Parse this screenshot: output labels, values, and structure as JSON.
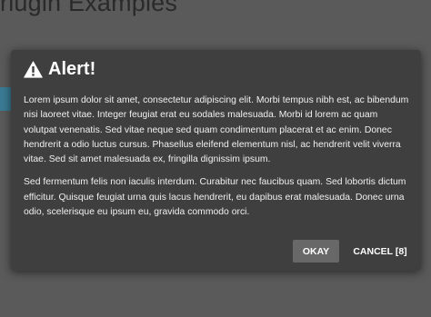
{
  "background": {
    "heading": "rlugin Examples"
  },
  "dialog": {
    "icon": "warning-icon",
    "title": "Alert!",
    "paragraphs": [
      "Lorem ipsum dolor sit amet, consectetur adipiscing elit. Morbi tempus nibh est, ac bibendum nisi laoreet vitae. Integer feugiat erat eu sodales malesuada. Morbi id lorem ac quam volutpat venenatis. Sed vitae neque sed quam condimentum placerat et ac enim. Donec hendrerit a odio luctus cursus. Phasellus eleifend elementum nisl, ac hendrerit velit viverra vitae. Sed sit amet malesuada ex, fringilla dignissim ipsum.",
      "Sed fermentum felis non iaculis interdum. Curabitur nec faucibus quam. Sed lobortis dictum efficitur. Quisque feugiat urna quis lacus hendrerit, eu dapibus erat malesuada. Donec urna odio, scelerisque eu ipsum eu, gravida commodo orci."
    ],
    "buttons": {
      "ok_label": "OKAY",
      "cancel_label": "CANCEL [8]"
    }
  },
  "colors": {
    "overlay": "#5a5a5a",
    "dialog_bg": "#3f3f3f",
    "ok_button_bg": "#686868",
    "accent_tab": "#3a7a93"
  }
}
